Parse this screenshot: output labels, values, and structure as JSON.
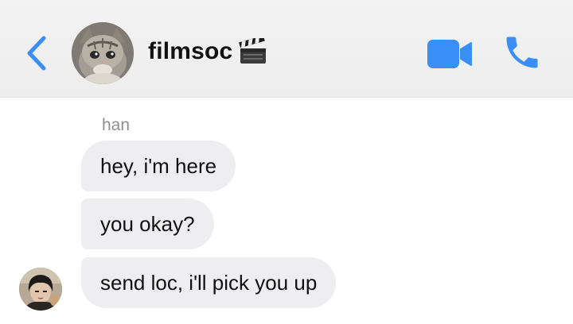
{
  "header": {
    "title": "filmsoc",
    "title_emoji": "clapper-board-icon",
    "accent_color": "#3a8ef6"
  },
  "messages": {
    "sender": "han",
    "items": [
      {
        "text": "hey, i'm here"
      },
      {
        "text": "you okay?"
      },
      {
        "text": "send loc, i'll pick you up"
      }
    ],
    "bubble_color": "#eeeef0"
  }
}
